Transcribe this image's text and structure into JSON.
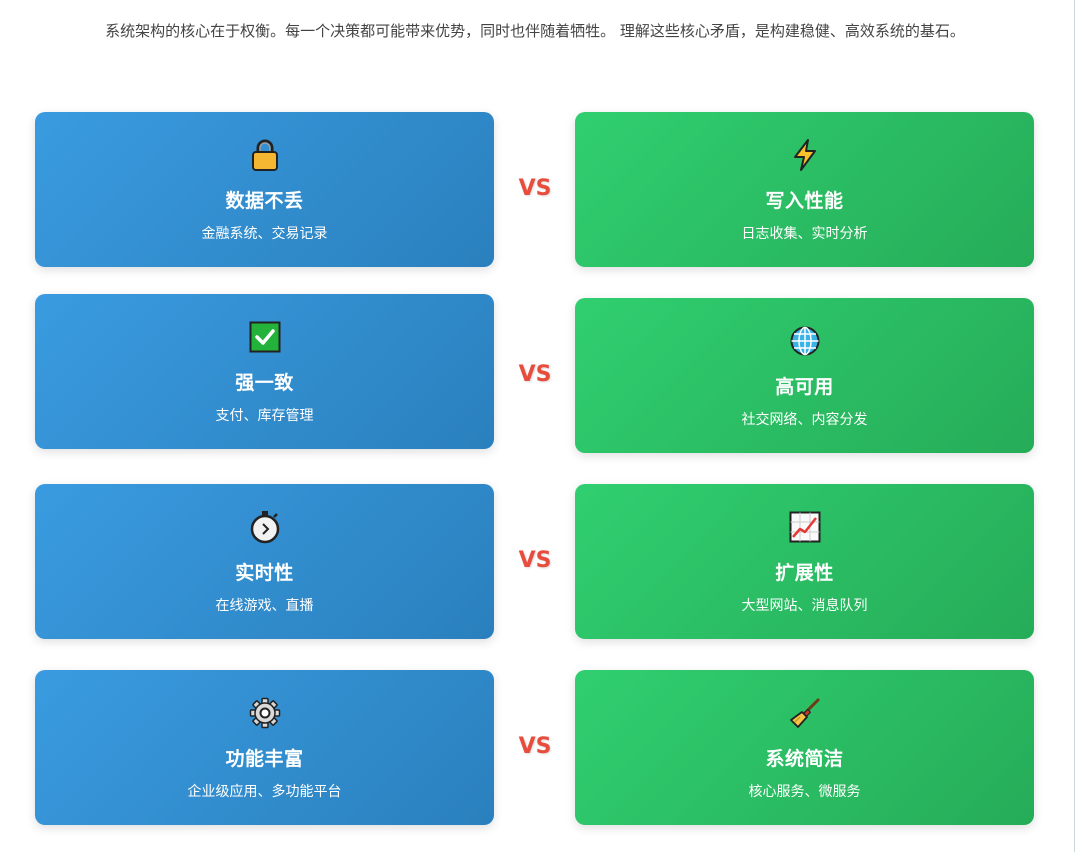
{
  "intro": "系统架构的核心在于权衡。每一个决策都可能带来优势，同时也伴随着牺牲。 理解这些核心矛盾，是构建稳健、高效系统的基石。",
  "vs_label": "VS",
  "pairs": [
    {
      "left": {
        "icon": "lock-icon",
        "title": "数据不丢",
        "subtitle": "金融系统、交易记录"
      },
      "right": {
        "icon": "lightning-icon",
        "title": "写入性能",
        "subtitle": "日志收集、实时分析"
      }
    },
    {
      "left": {
        "icon": "check-mark-icon",
        "title": "强一致",
        "subtitle": "支付、库存管理"
      },
      "right": {
        "icon": "globe-icon",
        "title": "高可用",
        "subtitle": "社交网络、内容分发"
      }
    },
    {
      "left": {
        "icon": "stopwatch-icon",
        "title": "实时性",
        "subtitle": "在线游戏、直播"
      },
      "right": {
        "icon": "chart-increasing-icon",
        "title": "扩展性",
        "subtitle": "大型网站、消息队列"
      }
    },
    {
      "left": {
        "icon": "gear-icon",
        "title": "功能丰富",
        "subtitle": "企业级应用、多功能平台"
      },
      "right": {
        "icon": "broom-icon",
        "title": "系统简洁",
        "subtitle": "核心服务、微服务"
      }
    }
  ],
  "colors": {
    "blue": "#3a9be0",
    "green": "#30cf70",
    "vs": "#e74c3c"
  }
}
